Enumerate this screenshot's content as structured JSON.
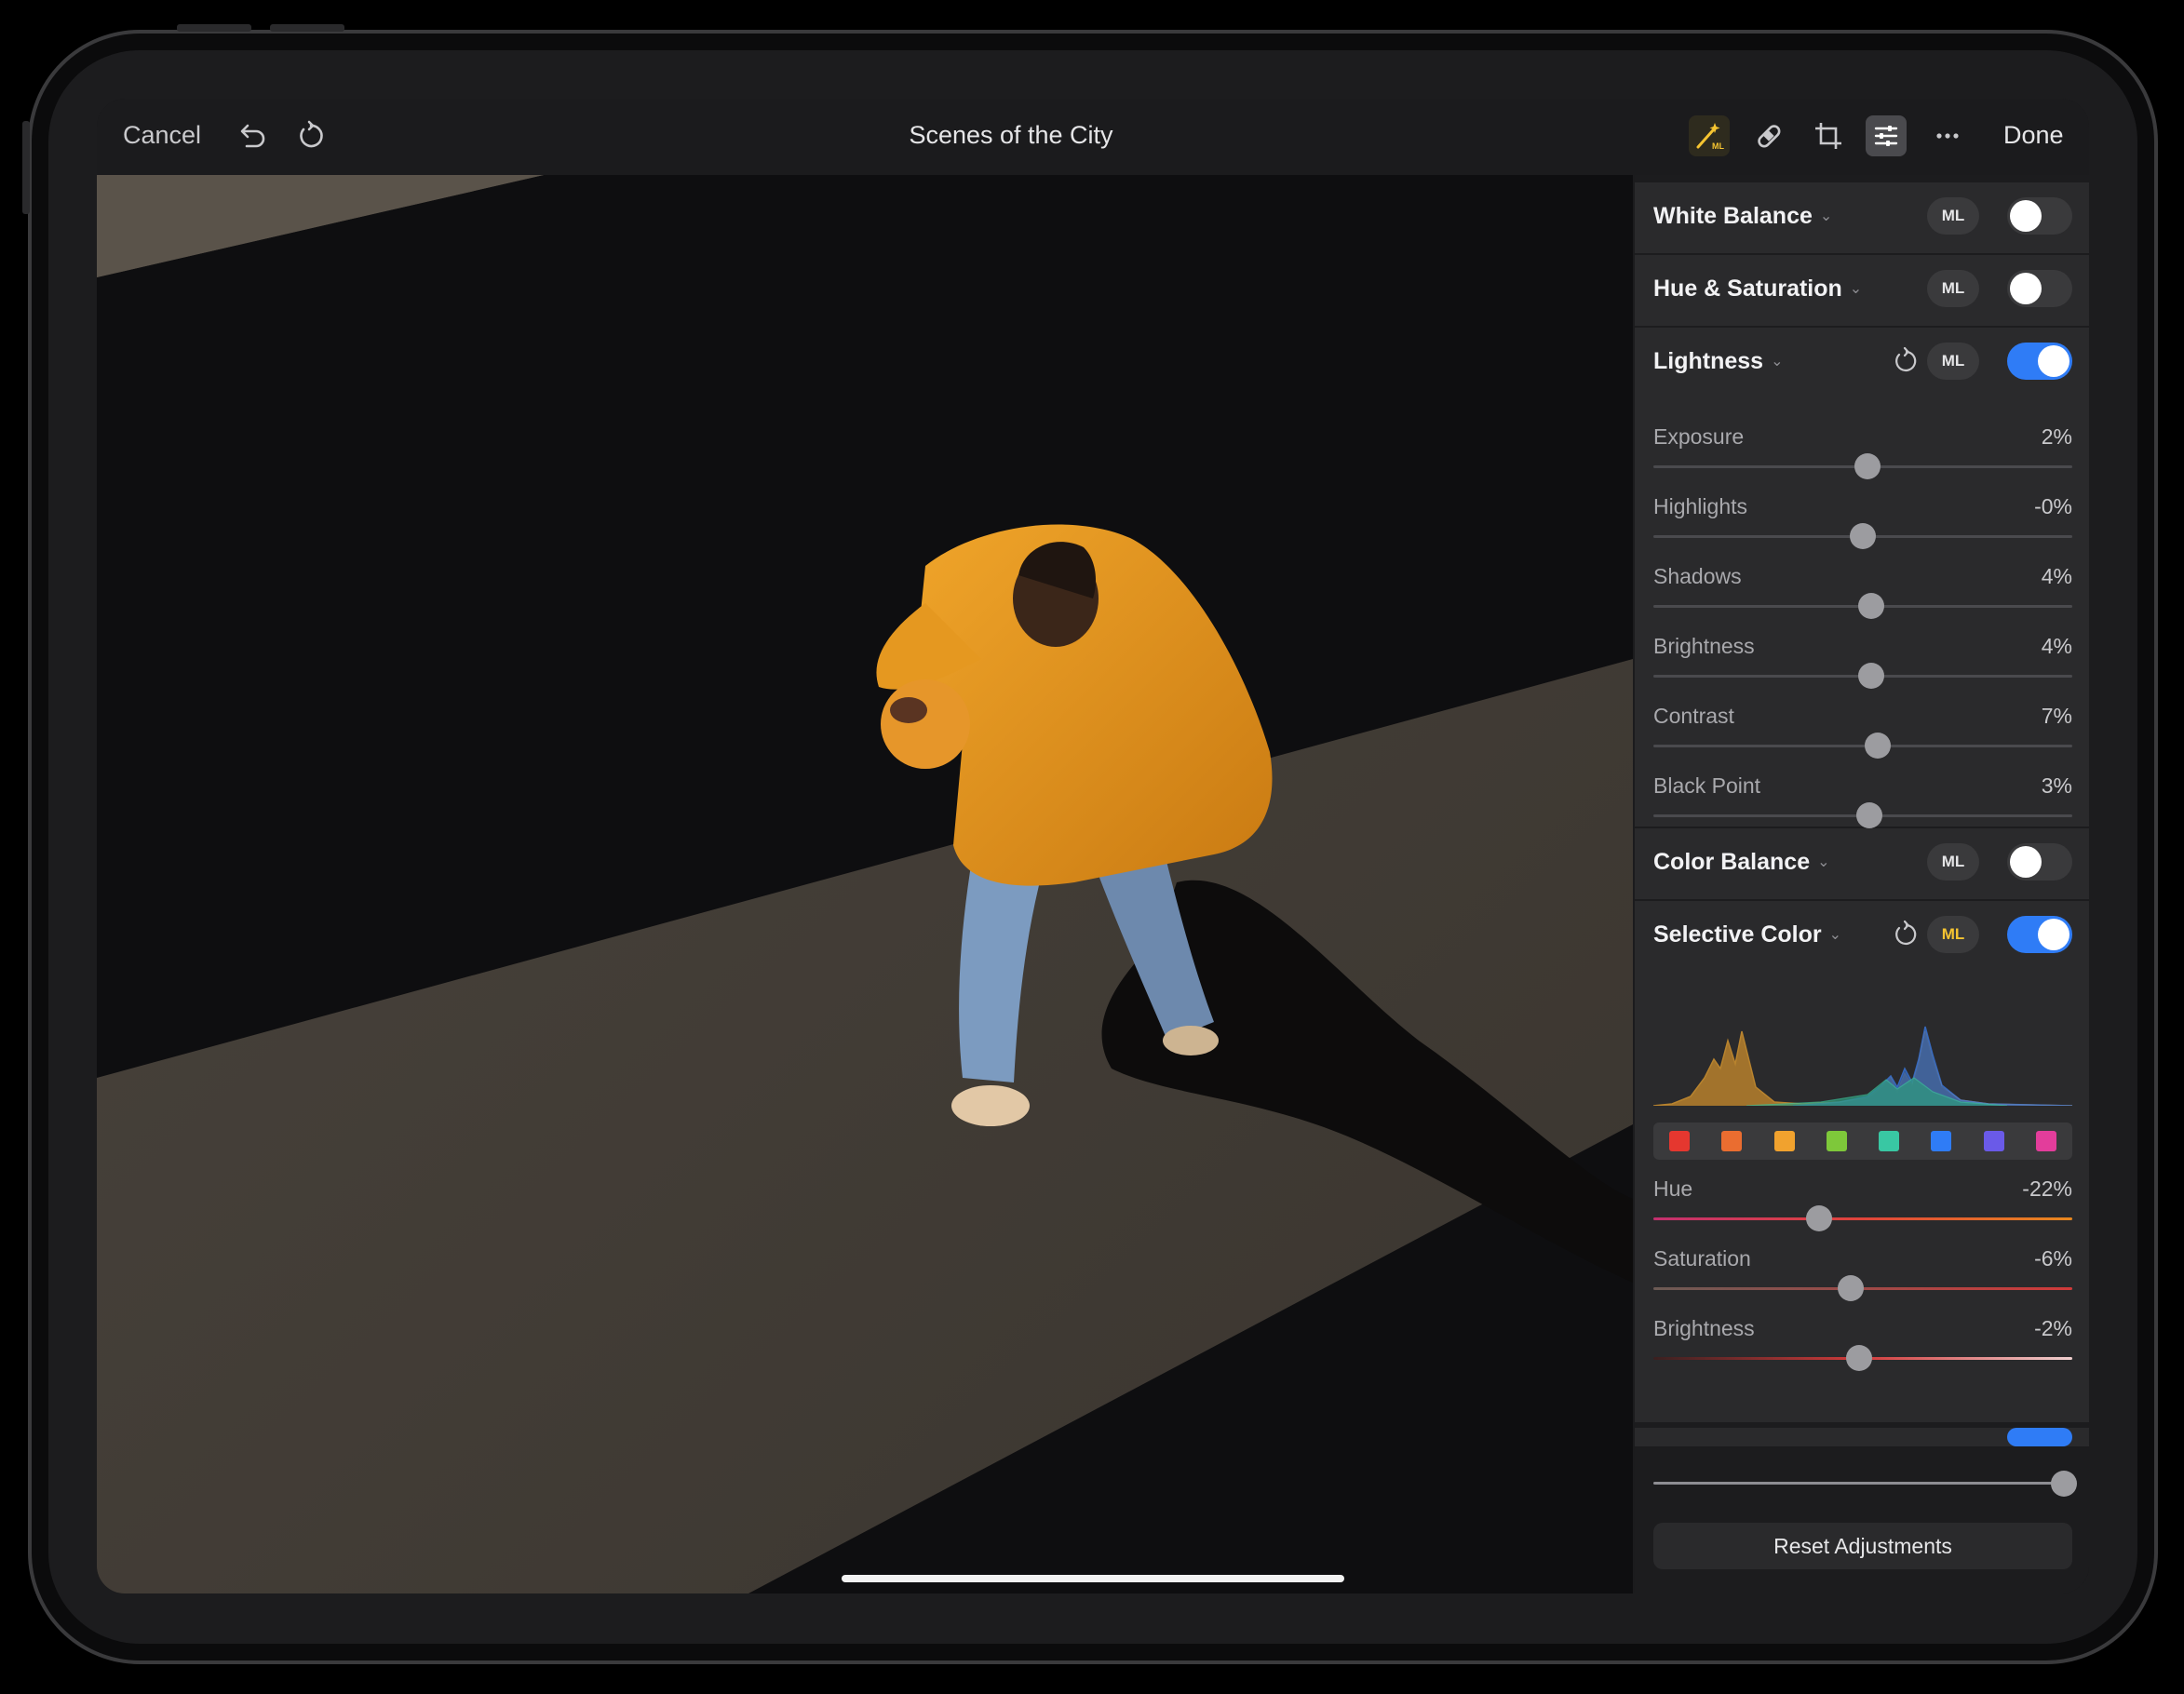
{
  "toolbar": {
    "cancel_label": "Cancel",
    "title": "Scenes of the City",
    "done_label": "Done"
  },
  "panel": {
    "white_balance": {
      "title": "White Balance",
      "ml": "ML",
      "enabled": false
    },
    "hue_saturation": {
      "title": "Hue & Saturation",
      "ml": "ML",
      "enabled": false
    },
    "lightness": {
      "title": "Lightness",
      "ml": "ML",
      "enabled": true,
      "sliders": [
        {
          "label": "Exposure",
          "value": "2%",
          "position": 0.51
        },
        {
          "label": "Highlights",
          "value": "-0%",
          "position": 0.5
        },
        {
          "label": "Shadows",
          "value": "4%",
          "position": 0.52
        },
        {
          "label": "Brightness",
          "value": "4%",
          "position": 0.52
        },
        {
          "label": "Contrast",
          "value": "7%",
          "position": 0.535
        },
        {
          "label": "Black Point",
          "value": "3%",
          "position": 0.515
        }
      ]
    },
    "color_balance": {
      "title": "Color Balance",
      "ml": "ML",
      "enabled": false
    },
    "selective_color": {
      "title": "Selective Color",
      "ml": "ML",
      "enabled": true,
      "swatch_colors": [
        "#e5372f",
        "#ea6d30",
        "#f1a22e",
        "#7ec83a",
        "#39c7a3",
        "#2f7cf6",
        "#6a5ae8",
        "#e33d9b"
      ],
      "sliders": [
        {
          "label": "Hue",
          "value": "-22%",
          "position": 0.395
        },
        {
          "label": "Saturation",
          "value": "-6%",
          "position": 0.47
        },
        {
          "label": "Brightness",
          "value": "-2%",
          "position": 0.49
        }
      ]
    },
    "master_slider_position": 0.98,
    "reset_label": "Reset Adjustments"
  },
  "colors": {
    "accent": "#2f7cf6",
    "ml_gold": "#f5c431",
    "jacket": "#e8981f"
  }
}
